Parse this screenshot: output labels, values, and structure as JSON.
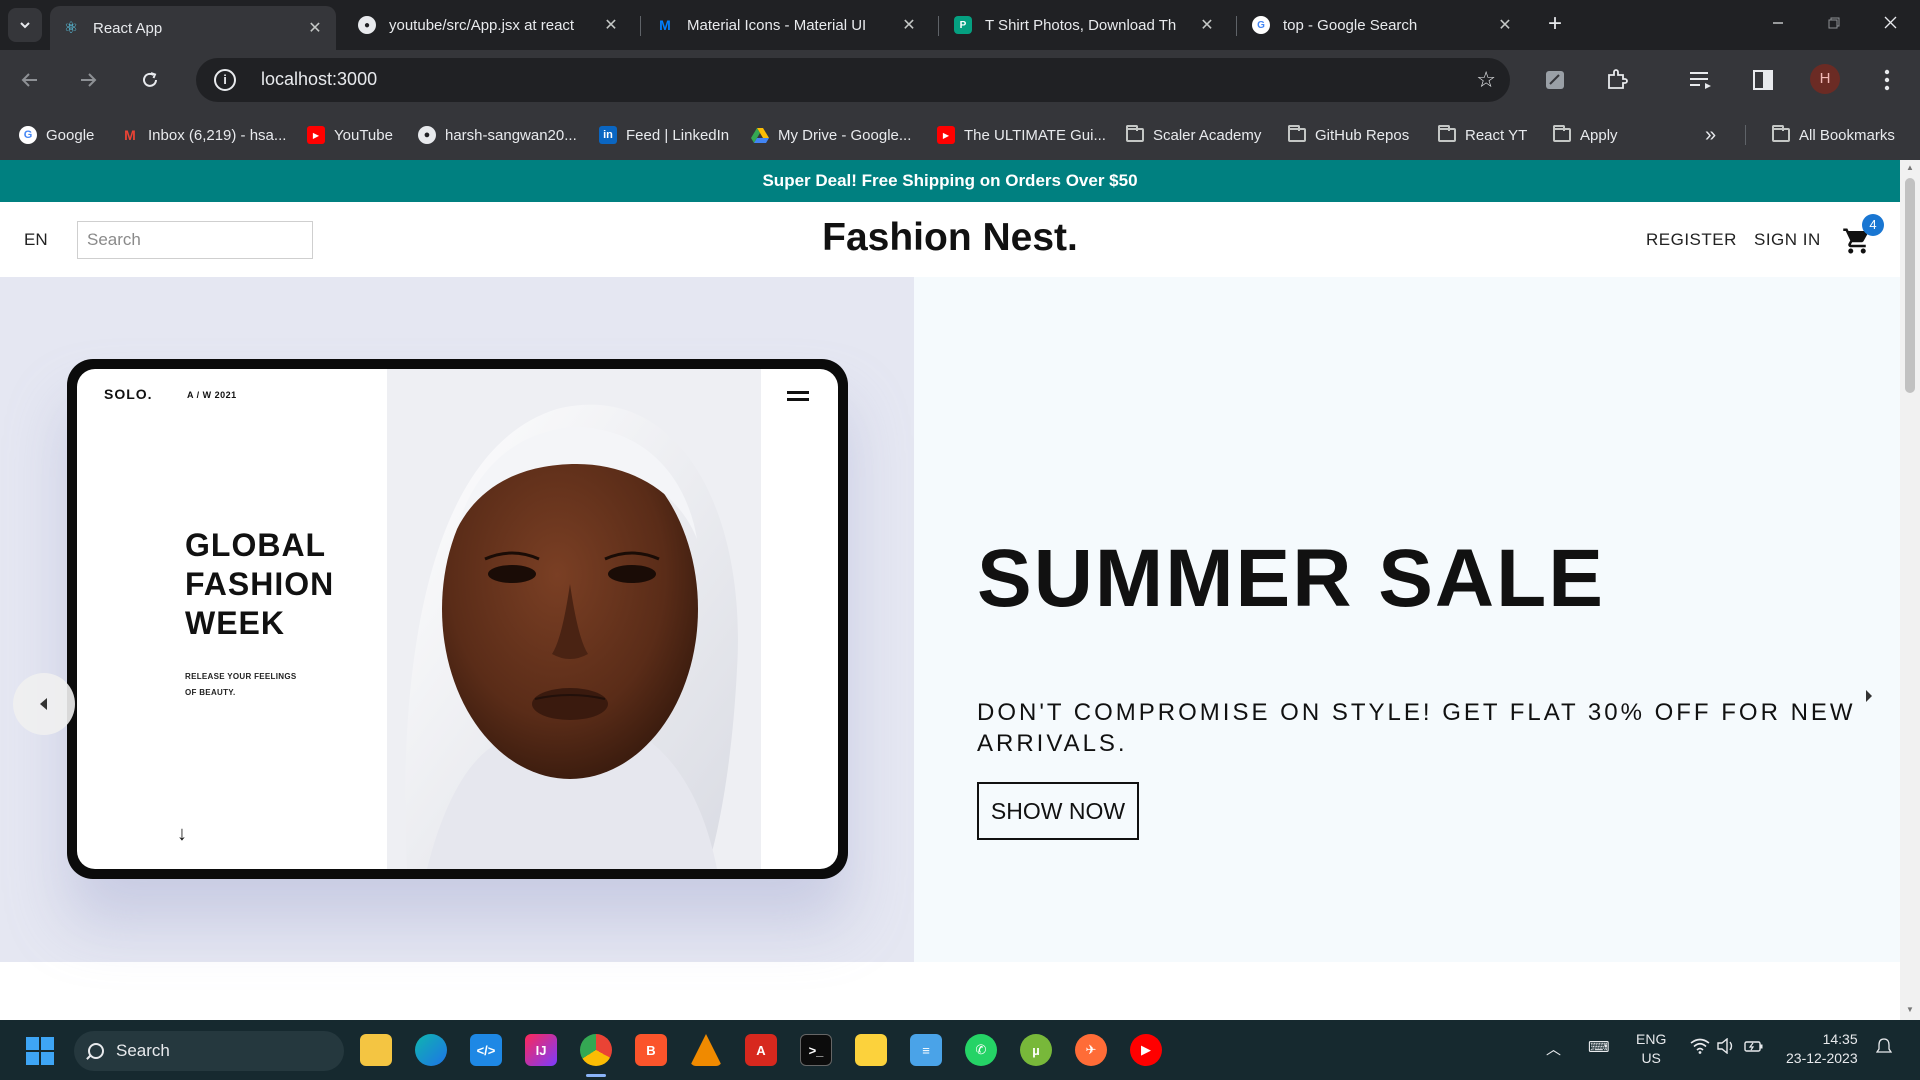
{
  "browser": {
    "tabs": [
      {
        "title": "React App",
        "favicon": "react-icon",
        "active": true
      },
      {
        "title": "youtube/src/App.jsx at react",
        "favicon": "github-icon",
        "active": false
      },
      {
        "title": "Material Icons - Material UI",
        "favicon": "mui-icon",
        "active": false
      },
      {
        "title": "T Shirt Photos, Download Th",
        "favicon": "pexels-icon",
        "active": false
      },
      {
        "title": "top - Google Search",
        "favicon": "google-icon",
        "active": false
      }
    ],
    "close_glyph": "✕",
    "new_tab_glyph": "+",
    "url": "localhost:3000",
    "profile_initial": "H",
    "bookmarks": [
      {
        "label": "Google",
        "icon": "google-icon"
      },
      {
        "label": "Inbox (6,219) - hsa...",
        "icon": "gmail-icon"
      },
      {
        "label": "YouTube",
        "icon": "youtube-icon"
      },
      {
        "label": "harsh-sangwan20...",
        "icon": "github-icon"
      },
      {
        "label": "Feed | LinkedIn",
        "icon": "linkedin-icon"
      },
      {
        "label": "My Drive - Google...",
        "icon": "drive-icon"
      },
      {
        "label": "The ULTIMATE Gui...",
        "icon": "youtube-icon"
      },
      {
        "label": "Scaler Academy",
        "icon": "folder-icon"
      },
      {
        "label": "GitHub Repos",
        "icon": "folder-icon"
      },
      {
        "label": "React YT",
        "icon": "folder-icon"
      },
      {
        "label": "Apply",
        "icon": "folder-icon"
      }
    ],
    "bookmarks_overflow": "»",
    "all_bookmarks": "All Bookmarks"
  },
  "site": {
    "announcement": "Super Deal! Free Shipping on Orders Over $50",
    "nav": {
      "language": "EN",
      "search_placeholder": "Search",
      "logo": "Fashion Nest.",
      "register": "REGISTER",
      "sign_in": "SIGN IN",
      "cart_count": "4"
    },
    "slide": {
      "title": "SUMMER SALE",
      "description": "DON'T COMPROMISE ON STYLE! GET FLAT 30% OFF FOR NEW ARRIVALS.",
      "button": "SHOW NOW",
      "image": {
        "brand": "SOLO.",
        "season": "A / W 2021",
        "headline_lines": [
          "GLOBAL",
          "FASHION",
          "WEEK"
        ],
        "subtext_lines": [
          "RELEASE YOUR FEELINGS",
          "OF BEAUTY."
        ],
        "arrow": "↓"
      }
    },
    "colors": {
      "announcement_bg": "#008080",
      "cart_badge": "#1976d2"
    }
  },
  "taskbar": {
    "search_label": "Search",
    "apps": [
      "file-explorer-icon",
      "edge-icon",
      "vscode-icon",
      "intellij-icon",
      "chrome-icon",
      "brave-icon",
      "vlc-icon",
      "acrobat-icon",
      "terminal-icon",
      "sticky-notes-icon",
      "notepad-icon",
      "whatsapp-icon",
      "utorrent-icon",
      "postman-icon",
      "youtube-music-icon"
    ],
    "lang_line1": "ENG",
    "lang_line2": "US",
    "time": "14:35",
    "date": "23-12-2023"
  }
}
